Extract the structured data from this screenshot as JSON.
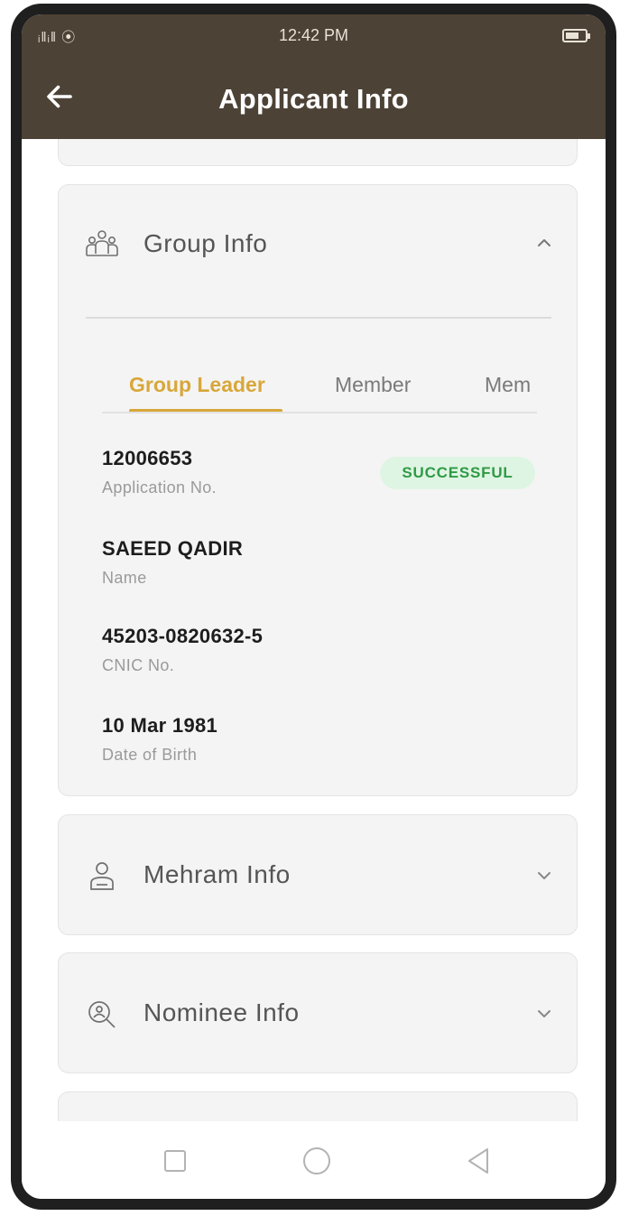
{
  "status_bar": {
    "signal": "ᵢ‖ᵢ‖ ⦿",
    "time": "12:42 PM"
  },
  "app_bar": {
    "title": "Applicant Info"
  },
  "sections": {
    "group": {
      "title": "Group Info",
      "expanded": true,
      "tabs": [
        "Group Leader",
        "Member",
        "Mem"
      ],
      "active_tab": "Group Leader",
      "status": "SUCCESSFUL",
      "fields": {
        "application_no": {
          "value": "12006653",
          "label": "Application No."
        },
        "name": {
          "value": "SAEED QADIR",
          "label": "Name"
        },
        "cnic": {
          "value": "45203-0820632-5",
          "label": "CNIC No."
        },
        "dob": {
          "value": "10 Mar 1981",
          "label": "Date of Birth"
        }
      }
    },
    "mehram": {
      "title": "Mehram Info",
      "expanded": false
    },
    "nominee": {
      "title": "Nominee Info",
      "expanded": false
    }
  },
  "colors": {
    "header": "#4d4236",
    "accent": "#d8a73a",
    "success_text": "#2f9a45",
    "success_bg": "#dff5e3"
  },
  "icons": {
    "back": "arrow-left-icon",
    "group": "group-icon",
    "mehram": "person-icon",
    "nominee": "search-person-icon",
    "chevron_up": "chevron-up-icon",
    "chevron_down": "chevron-down-icon"
  }
}
